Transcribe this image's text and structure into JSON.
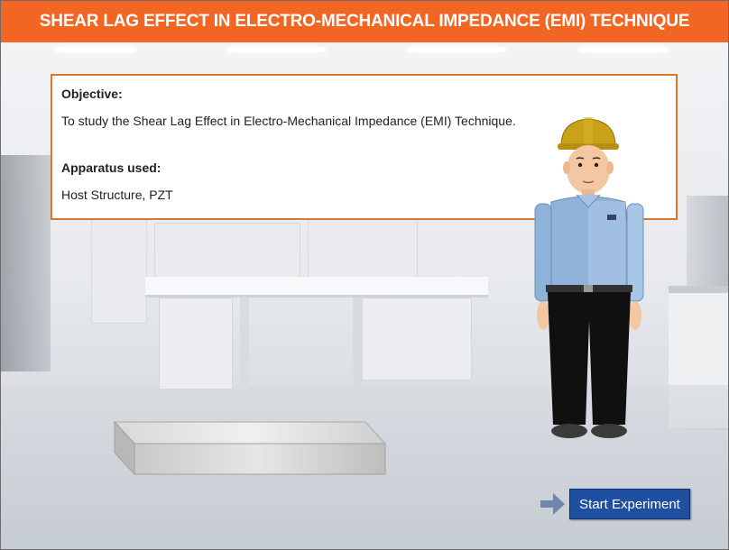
{
  "header": {
    "title": "SHEAR LAG EFFECT IN ELECTRO-MECHANICAL IMPEDANCE (EMI) TECHNIQUE"
  },
  "info": {
    "objective_heading": "Objective:",
    "objective_text": "To study the Shear Lag Effect in Electro-Mechanical Impedance (EMI) Technique.",
    "apparatus_heading": "Apparatus used:",
    "apparatus_text": "Host Structure, PZT"
  },
  "actions": {
    "start_label": "Start Experiment"
  },
  "colors": {
    "header_bg": "#f26522",
    "info_border": "#d9772a",
    "button_bg": "#1e4fa0",
    "arrow": "#6f86ad"
  },
  "icons": {
    "arrow": "right-arrow-icon",
    "character": "engineer-character",
    "block": "metal-block"
  }
}
